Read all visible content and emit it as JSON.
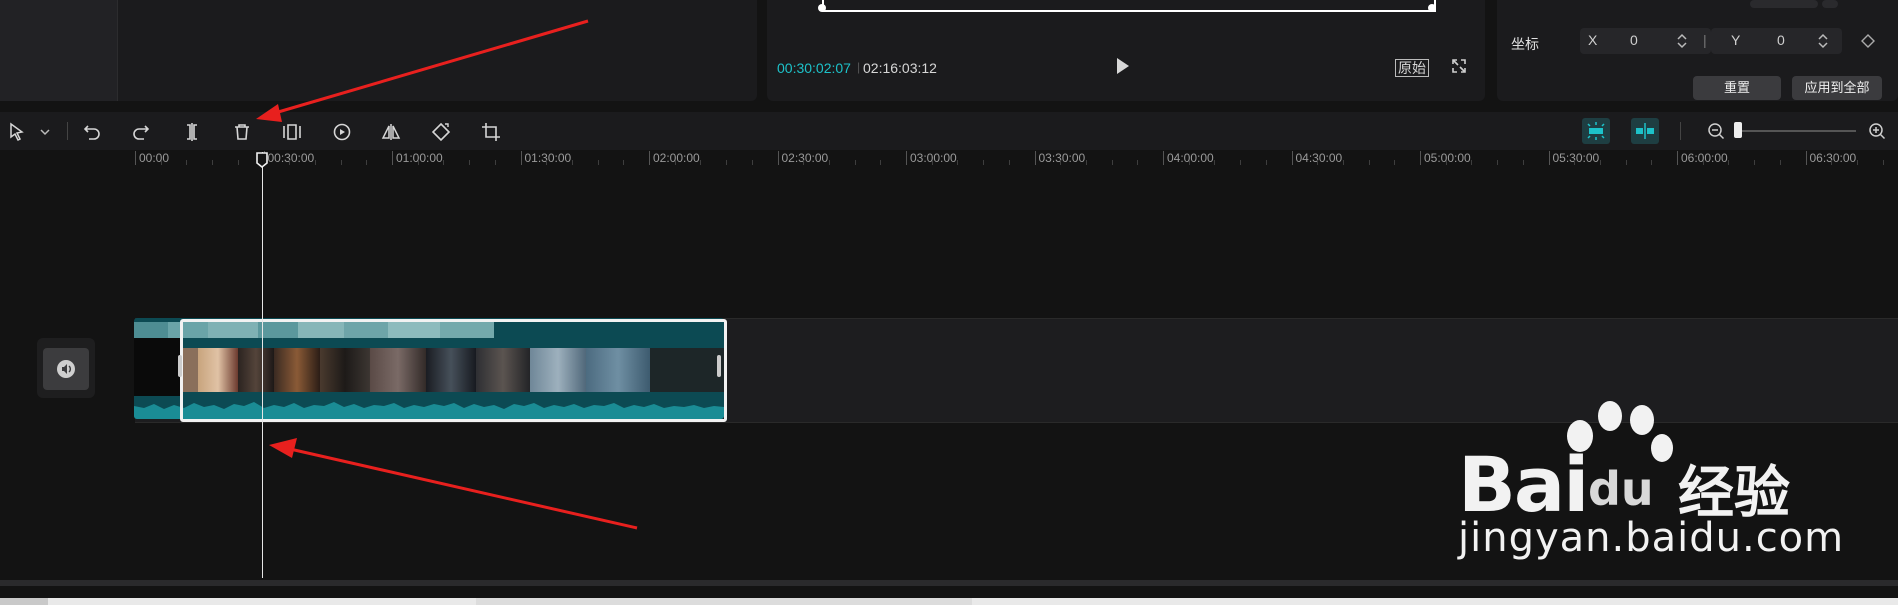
{
  "preview": {
    "current_time": "00:30:02:07",
    "separator": "|",
    "total_time": "02:16:03:12",
    "original_label": "原始"
  },
  "properties": {
    "coord_label": "坐标",
    "x_label": "X",
    "x_value": "0",
    "y_sep": "|",
    "y_label": "Y",
    "y_value": "0",
    "reset_label": "重置",
    "apply_all_label": "应用到全部"
  },
  "toolbar": {
    "icons": [
      "select-icon",
      "undo-icon",
      "redo-icon",
      "split-icon",
      "delete-icon",
      "freeze-frame-icon",
      "speed-icon",
      "mirror-icon",
      "rotate-icon",
      "crop-icon"
    ],
    "accent_color": "#1dc2c9"
  },
  "timeline": {
    "ruler_labels": [
      "00:00",
      "00:30:00",
      "01:00:00",
      "01:30:00",
      "02:00:00",
      "02:30:00",
      "03:00:00",
      "03:30:00",
      "04:00:00",
      "04:30:00",
      "05:00:00",
      "05:30:00",
      "06:00:00",
      "06:30:00"
    ],
    "clip_color": "#0c4a53",
    "waveform_color": "#1a8c95"
  },
  "annotations": {
    "arrow_color": "#e8201e"
  },
  "watermark": {
    "brand_text": "Bai",
    "brand_text2": "du",
    "cn_text": "经验",
    "url": "jingyan.baidu.com"
  }
}
